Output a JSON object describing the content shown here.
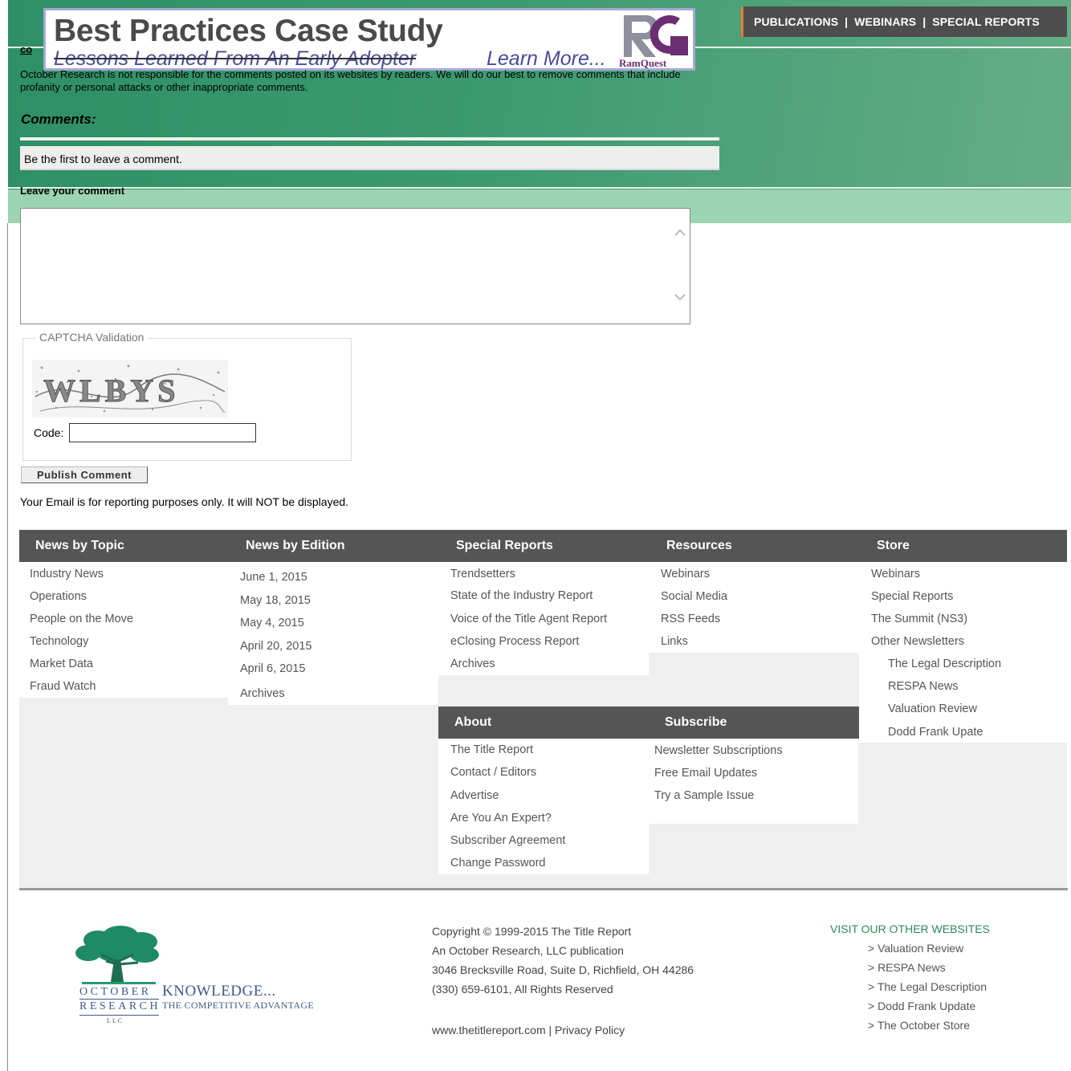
{
  "top_nav": {
    "publications": "PUBLICATIONS",
    "sep1": "|",
    "webinars": "WEBINARS",
    "sep2": "|",
    "special_reports": "SPECIAL REPORTS"
  },
  "ad_banner": {
    "title": "Best Practices Case Study",
    "subtitle": "Lessons Learned From An Early Adopter",
    "cta": "Learn More...",
    "logo_text": "RamQuest"
  },
  "comments": {
    "co_label": "co",
    "disclaimer": "October Research is not responsible for the comments posted on its websites by readers. We will do our best to remove comments that include profanity or personal attacks or other inappropriate comments.",
    "heading": "Comments:",
    "empty_message": "Be the first to leave a comment.",
    "leave_heading": "Leave your comment",
    "textarea_value": "",
    "captcha_legend": "CAPTCHA Validation",
    "captcha_text": "WLBYS",
    "code_label": "Code:",
    "code_value": "",
    "publish_button": "Publish Comment",
    "email_note": "Your Email is for reporting purposes only. It will NOT be displayed."
  },
  "footer_menu": {
    "news_by_topic": {
      "heading": "News by Topic",
      "items": [
        "Industry News",
        "Operations",
        "People on the Move",
        "Technology",
        "Market Data",
        "Fraud Watch"
      ]
    },
    "news_by_edition": {
      "heading": "News by Edition",
      "items": [
        "June 1, 2015",
        "May 18, 2015",
        "May 4, 2015",
        "April 20, 2015",
        "April 6, 2015",
        "Archives"
      ]
    },
    "special_reports": {
      "heading": "Special Reports",
      "items": [
        "Trendsetters",
        "State of the Industry Report",
        "Voice of the Title Agent Report",
        "eClosing Process Report",
        "Archives"
      ]
    },
    "resources": {
      "heading": "Resources",
      "items": [
        "Webinars",
        "Social Media",
        "RSS Feeds",
        "Links"
      ]
    },
    "store": {
      "heading": "Store",
      "items": [
        "Webinars",
        "Special Reports",
        "The Summit (NS3)",
        "Other Newsletters"
      ],
      "subitems": [
        "The Legal Description",
        "RESPA News",
        "Valuation Review",
        "Dodd Frank Upate"
      ]
    },
    "about": {
      "heading": "About",
      "items": [
        "The Title Report",
        "Contact / Editors",
        "Advertise",
        "Are You An Expert?",
        "Subscriber Agreement",
        "Change Password"
      ]
    },
    "subscribe": {
      "heading": "Subscribe",
      "items": [
        "Newsletter Subscriptions",
        "Free Email Updates",
        "Try a Sample Issue"
      ]
    }
  },
  "bottom": {
    "logo": {
      "line1": "OCTOBER",
      "line2": "RESEARCH",
      "line3": "LLC",
      "tagline1": "KNOWLEDGE...",
      "tagline2": "THE COMPETITIVE ADVANTAGE"
    },
    "copyright": "Copyright © 1999-2015 The Title Report",
    "publisher": "An October Research, LLC publication",
    "address": "3046 Brecksville Road, Suite D, Richfield, OH 44286",
    "phone": "(330) 659-6101, All Rights Reserved",
    "site_link": "www.thetitlereport.com",
    "link_sep": "|",
    "privacy_link": "Privacy Policy",
    "visit_heading": "VISIT OUR OTHER WEBSITES",
    "other_sites": [
      "> Valuation Review",
      "> RESPA News",
      "> The Legal Description",
      "> Dodd Frank Update",
      "> The October Store"
    ]
  },
  "colors": {
    "header_green": "#2e8f66",
    "header_light_green": "#9bd4b0",
    "nav_dark": "#4d4d4d",
    "nav_accent": "#e87b2d",
    "menu_header": "#555555",
    "visit_green": "#2f8a5b"
  }
}
